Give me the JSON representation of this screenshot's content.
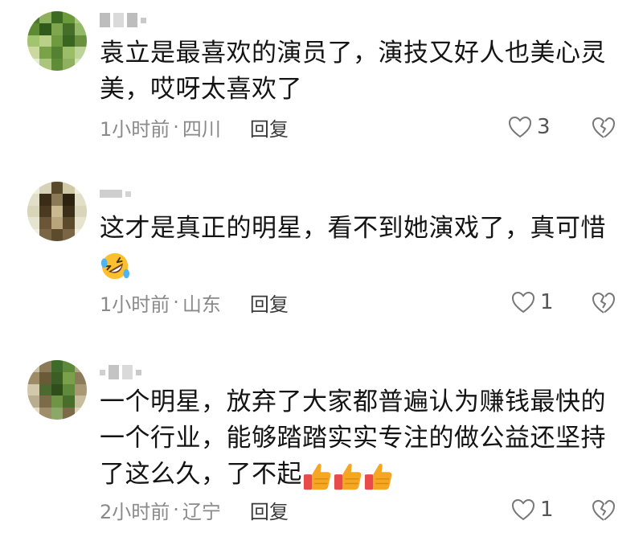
{
  "comments": [
    {
      "text_lines": [
        "袁立是最喜欢的演员了，演技又好人也美心灵",
        "美，哎呀太喜欢了"
      ],
      "time": "1小时前",
      "location": "四川",
      "separator": "·",
      "reply_label": "回复",
      "likes": "3"
    },
    {
      "text_lines": [
        "这才是真正的明星，看不到她演戏了，真可惜"
      ],
      "emoji": "rolling-on-floor-laughing-icon",
      "time": "1小时前",
      "location": "山东",
      "separator": "·",
      "reply_label": "回复",
      "likes": "1"
    },
    {
      "text_lines": [
        "一个明星，放弃了大家都普遍认为赚钱最快的",
        "一个行业，能够踏踏实实专注的做公益还坚持",
        "了这么久，了不起"
      ],
      "emoji": "thumbs-up-icon",
      "time": "2小时前",
      "location": "辽宁",
      "separator": "·",
      "reply_label": "回复",
      "likes": "1"
    }
  ],
  "colors": {
    "text": "#141414",
    "meta": "#8a8a8a",
    "reply": "#3a3a3a",
    "thumb": "#f5a623",
    "sleeve": "#e94a4a"
  }
}
